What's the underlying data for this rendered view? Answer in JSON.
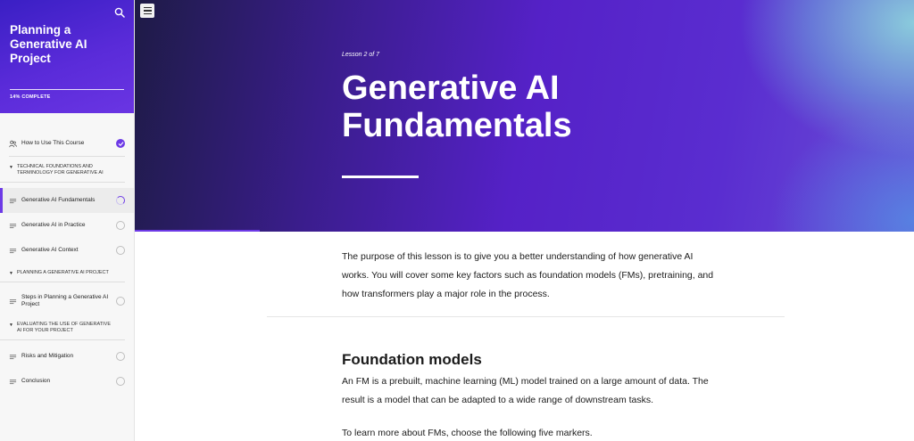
{
  "sidebar": {
    "course_title": "Planning a Generative AI Project",
    "progress_text": "14% COMPLETE",
    "search_icon": "search-icon",
    "items": [
      {
        "label": "How to Use This Course",
        "icon": "people-icon",
        "status": "complete"
      },
      {
        "label": "TECHNICAL FOUNDATIONS AND TERMINOLOGY FOR GENERATIVE AI",
        "type": "section"
      },
      {
        "label": "Generative AI Fundamentals",
        "icon": "lines-icon",
        "status": "in-progress"
      },
      {
        "label": "Generative AI in Practice",
        "icon": "lines-icon",
        "status": "not-started"
      },
      {
        "label": "Generative AI Context",
        "icon": "lines-icon",
        "status": "not-started"
      },
      {
        "label": "PLANNING A GENERATIVE AI PROJECT",
        "type": "section"
      },
      {
        "label": "Steps in Planning a Generative AI Project",
        "icon": "lines-icon",
        "status": "not-started"
      },
      {
        "label": "EVALUATING THE USE OF GENERATIVE AI FOR YOUR PROJECT",
        "type": "section"
      },
      {
        "label": "Risks and Mitigation",
        "icon": "lines-icon",
        "status": "not-started"
      },
      {
        "label": "Conclusion",
        "icon": "lines-icon",
        "status": "not-started"
      }
    ]
  },
  "hero": {
    "lesson_number": "Lesson 2 of 7",
    "title": "Generative AI Fundamentals"
  },
  "content": {
    "intro": "The purpose of this lesson is to give you a better understanding of how generative AI works. You will cover some key factors such as foundation models (FMs), pretraining, and how transformers play a major role in the process.",
    "section_title": "Foundation models",
    "section_text": "An FM is a prebuilt, machine learning (ML) model trained on a large amount of data. The result is a model that can be adapted to a wide range of downstream tasks.",
    "more_text": "To learn more about FMs, choose the following five markers."
  },
  "colors": {
    "accent": "#6d3ae6",
    "hero_start": "#1e1b46",
    "hero_mid": "#5521c7"
  }
}
